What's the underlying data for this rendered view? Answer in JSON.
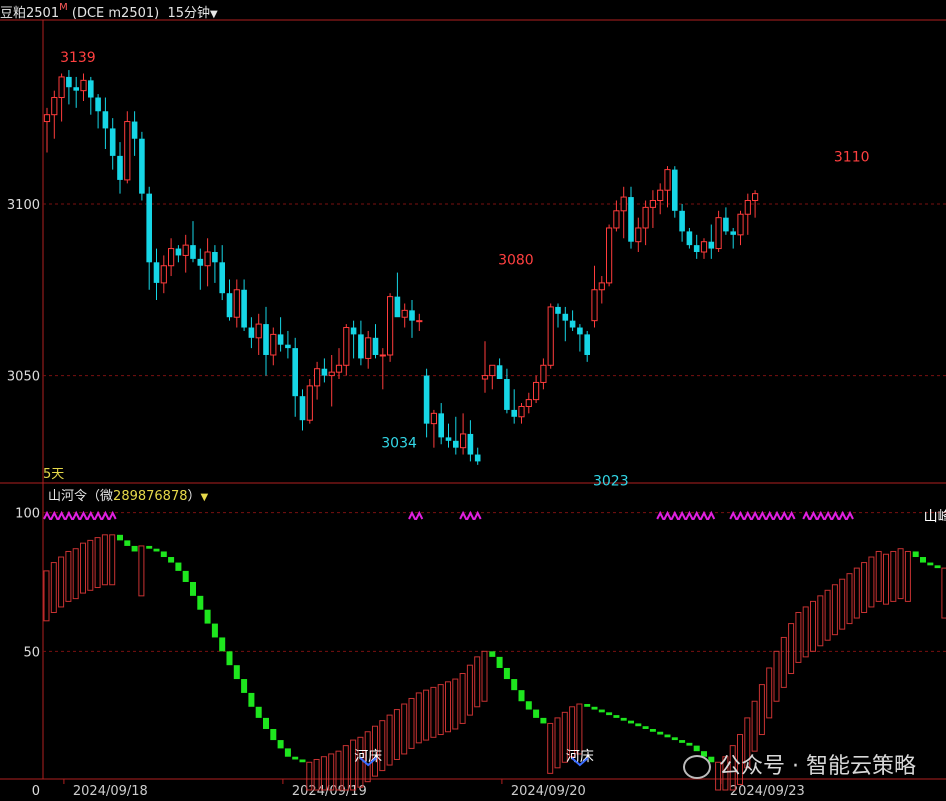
{
  "header": {
    "symbol": "豆粕2501",
    "marker": "M",
    "code": "(DCE m2501)",
    "period": "15分钟",
    "arrow": "▼"
  },
  "ma_label": "5天",
  "indicator_header": {
    "name": "山河令",
    "open": "（",
    "prefix": "微",
    "value": "289876878",
    "close": "）",
    "arrow": "▼"
  },
  "watermark": "公众号 · 智能云策略",
  "colors": {
    "up": "#ff3c3c",
    "down": "#16d6e6",
    "grid": "#7a1010",
    "axis": "#b02020",
    "ind_up": "#c83232",
    "ind_down": "#1ee61e",
    "zig": "#e020e0",
    "label_red": "#ff4040",
    "label_cyan": "#33d6e6"
  },
  "chart_data": [
    {
      "type": "candlestick",
      "ylim": [
        3019,
        3153
      ],
      "yticks": [
        3100,
        3050
      ],
      "xticks": [
        {
          "label": "2024/09/18",
          "index": 3
        },
        {
          "label": "2024/09/19",
          "index": 33
        },
        {
          "label": "2024/09/20",
          "index": 63
        },
        {
          "label": "2024/09/23",
          "index": 93
        }
      ],
      "annotations": [
        {
          "text": "3139",
          "index": 3,
          "value": 3139,
          "pos": "above",
          "color": "red"
        },
        {
          "text": "3080",
          "index": 63,
          "value": 3080,
          "pos": "above",
          "color": "red"
        },
        {
          "text": "3110",
          "index": 109,
          "value": 3110,
          "pos": "above",
          "color": "red"
        },
        {
          "text": "3034",
          "index": 47,
          "value": 3034,
          "pos": "below",
          "color": "cyan"
        },
        {
          "text": "3023",
          "index": 76,
          "value": 3023,
          "pos": "below",
          "color": "cyan"
        }
      ],
      "ohlc": [
        [
          3124,
          3128,
          3115,
          3126
        ],
        [
          3126,
          3133,
          3119,
          3131
        ],
        [
          3131,
          3138,
          3124,
          3137
        ],
        [
          3137,
          3139,
          3129,
          3134
        ],
        [
          3134,
          3137,
          3128,
          3133
        ],
        [
          3133,
          3138,
          3130,
          3136
        ],
        [
          3136,
          3137,
          3126,
          3131
        ],
        [
          3131,
          3132,
          3122,
          3127
        ],
        [
          3127,
          3131,
          3116,
          3122
        ],
        [
          3122,
          3125,
          3110,
          3114
        ],
        [
          3114,
          3118,
          3103,
          3107
        ],
        [
          3107,
          3127,
          3106,
          3124
        ],
        [
          3124,
          3127,
          3114,
          3119
        ],
        [
          3119,
          3121,
          3101,
          3103
        ],
        [
          3103,
          3105,
          3075,
          3083
        ],
        [
          3083,
          3087,
          3072,
          3077
        ],
        [
          3077,
          3085,
          3074,
          3082
        ],
        [
          3082,
          3090,
          3079,
          3087
        ],
        [
          3087,
          3088,
          3083,
          3085
        ],
        [
          3085,
          3091,
          3080,
          3088
        ],
        [
          3088,
          3095,
          3083,
          3084
        ],
        [
          3084,
          3087,
          3075,
          3082
        ],
        [
          3082,
          3090,
          3076,
          3086
        ],
        [
          3086,
          3088,
          3077,
          3083
        ],
        [
          3083,
          3088,
          3072,
          3074
        ],
        [
          3074,
          3078,
          3066,
          3067
        ],
        [
          3067,
          3078,
          3064,
          3075
        ],
        [
          3075,
          3078,
          3063,
          3064
        ],
        [
          3064,
          3067,
          3058,
          3061
        ],
        [
          3061,
          3068,
          3056,
          3065
        ],
        [
          3065,
          3070,
          3050,
          3056
        ],
        [
          3056,
          3064,
          3053,
          3062
        ],
        [
          3062,
          3067,
          3057,
          3059
        ],
        [
          3059,
          3063,
          3055,
          3058
        ],
        [
          3058,
          3061,
          3038,
          3044
        ],
        [
          3044,
          3046,
          3034,
          3037
        ],
        [
          3037,
          3049,
          3036,
          3047
        ],
        [
          3047,
          3054,
          3043,
          3052
        ],
        [
          3052,
          3055,
          3048,
          3050
        ],
        [
          3050,
          3056,
          3041,
          3051
        ],
        [
          3051,
          3058,
          3049,
          3053
        ],
        [
          3053,
          3065,
          3050,
          3064
        ],
        [
          3064,
          3066,
          3055,
          3062
        ],
        [
          3062,
          3066,
          3053,
          3055
        ],
        [
          3055,
          3063,
          3052,
          3061
        ],
        [
          3061,
          3065,
          3055,
          3056
        ],
        [
          3056,
          3058,
          3046,
          3056
        ],
        [
          3056,
          3074,
          3054,
          3073
        ],
        [
          3073,
          3080,
          3068,
          3067
        ],
        [
          3067,
          3071,
          3064,
          3069
        ],
        [
          3069,
          3072,
          3061,
          3066
        ],
        [
          3066,
          3068,
          3063,
          3066
        ],
        [
          3050,
          3052,
          3032,
          3036
        ],
        [
          3036,
          3040,
          3029,
          3039
        ],
        [
          3039,
          3042,
          3030,
          3032
        ],
        [
          3032,
          3036,
          3029,
          3031
        ],
        [
          3031,
          3038,
          3027,
          3029
        ],
        [
          3029,
          3039,
          3027,
          3033
        ],
        [
          3033,
          3037,
          3025,
          3027
        ],
        [
          3027,
          3029,
          3024,
          3025
        ],
        [
          3049,
          3060,
          3045,
          3050
        ],
        [
          3050,
          3053,
          3046,
          3053
        ],
        [
          3053,
          3055,
          3049,
          3049
        ],
        [
          3049,
          3052,
          3039,
          3040
        ],
        [
          3040,
          3046,
          3036,
          3038
        ],
        [
          3038,
          3042,
          3036,
          3041
        ],
        [
          3041,
          3045,
          3039,
          3043
        ],
        [
          3043,
          3050,
          3042,
          3048
        ],
        [
          3048,
          3055,
          3046,
          3053
        ],
        [
          3053,
          3071,
          3052,
          3070
        ],
        [
          3070,
          3071,
          3064,
          3068
        ],
        [
          3068,
          3070,
          3060,
          3066
        ],
        [
          3066,
          3069,
          3063,
          3064
        ],
        [
          3064,
          3065,
          3057,
          3062
        ],
        [
          3062,
          3063,
          3054,
          3056
        ],
        [
          3066,
          3082,
          3064,
          3075
        ],
        [
          3075,
          3079,
          3071,
          3077
        ],
        [
          3077,
          3094,
          3076,
          3093
        ],
        [
          3093,
          3101,
          3092,
          3098
        ],
        [
          3098,
          3105,
          3090,
          3102
        ],
        [
          3102,
          3105,
          3087,
          3089
        ],
        [
          3089,
          3096,
          3086,
          3093
        ],
        [
          3093,
          3101,
          3088,
          3099
        ],
        [
          3099,
          3104,
          3093,
          3101
        ],
        [
          3101,
          3106,
          3097,
          3104
        ],
        [
          3104,
          3111,
          3099,
          3110
        ],
        [
          3110,
          3111,
          3096,
          3098
        ],
        [
          3098,
          3100,
          3089,
          3092
        ],
        [
          3092,
          3093,
          3087,
          3088
        ],
        [
          3088,
          3091,
          3084,
          3086
        ],
        [
          3086,
          3090,
          3084,
          3089
        ],
        [
          3089,
          3094,
          3084,
          3087
        ],
        [
          3087,
          3098,
          3086,
          3096
        ],
        [
          3096,
          3099,
          3091,
          3092
        ],
        [
          3092,
          3093,
          3087,
          3091
        ],
        [
          3091,
          3098,
          3088,
          3097
        ],
        [
          3097,
          3103,
          3091,
          3101
        ],
        [
          3101,
          3104,
          3096,
          3103
        ]
      ]
    },
    {
      "type": "bar",
      "ylim": [
        0,
        106
      ],
      "yticks": [
        100,
        50,
        0
      ],
      "values": [
        79,
        82,
        84,
        86,
        87,
        89,
        90,
        91,
        92,
        92,
        90,
        88,
        86,
        88,
        87,
        86,
        84,
        82,
        79,
        75,
        70,
        65,
        60,
        55,
        50,
        45,
        40,
        35,
        30,
        26,
        22,
        18,
        15,
        12,
        11,
        10,
        10,
        11,
        12,
        13,
        14,
        16,
        18,
        19,
        21,
        23,
        25,
        27,
        29,
        31,
        33,
        35,
        36,
        37,
        38,
        39,
        40,
        42,
        45,
        48,
        50,
        48,
        44,
        40,
        36,
        32,
        29,
        26,
        24,
        24,
        26,
        28,
        30,
        31,
        30,
        29,
        28,
        27,
        26,
        25,
        24,
        23,
        22,
        21,
        20,
        19,
        18,
        17,
        16,
        14,
        12,
        10,
        10,
        12,
        16,
        20,
        26,
        32,
        38,
        44,
        50,
        55,
        60,
        64,
        66,
        68,
        70,
        72,
        74,
        76,
        78,
        80,
        82,
        84,
        86,
        85,
        86,
        87,
        86,
        84,
        82,
        81,
        80,
        80,
        81,
        82
      ],
      "zigzag_bands": [
        [
          0,
          9
        ],
        [
          50,
          51
        ],
        [
          57,
          59
        ],
        [
          84,
          91
        ],
        [
          94,
          102
        ],
        [
          104,
          110
        ]
      ],
      "annotations": [
        {
          "text": "河床",
          "index": 44,
          "pos": "below"
        },
        {
          "text": "河床",
          "index": 73,
          "pos": "below"
        },
        {
          "text": "山峰",
          "index": 122,
          "pos": "top"
        }
      ]
    }
  ]
}
